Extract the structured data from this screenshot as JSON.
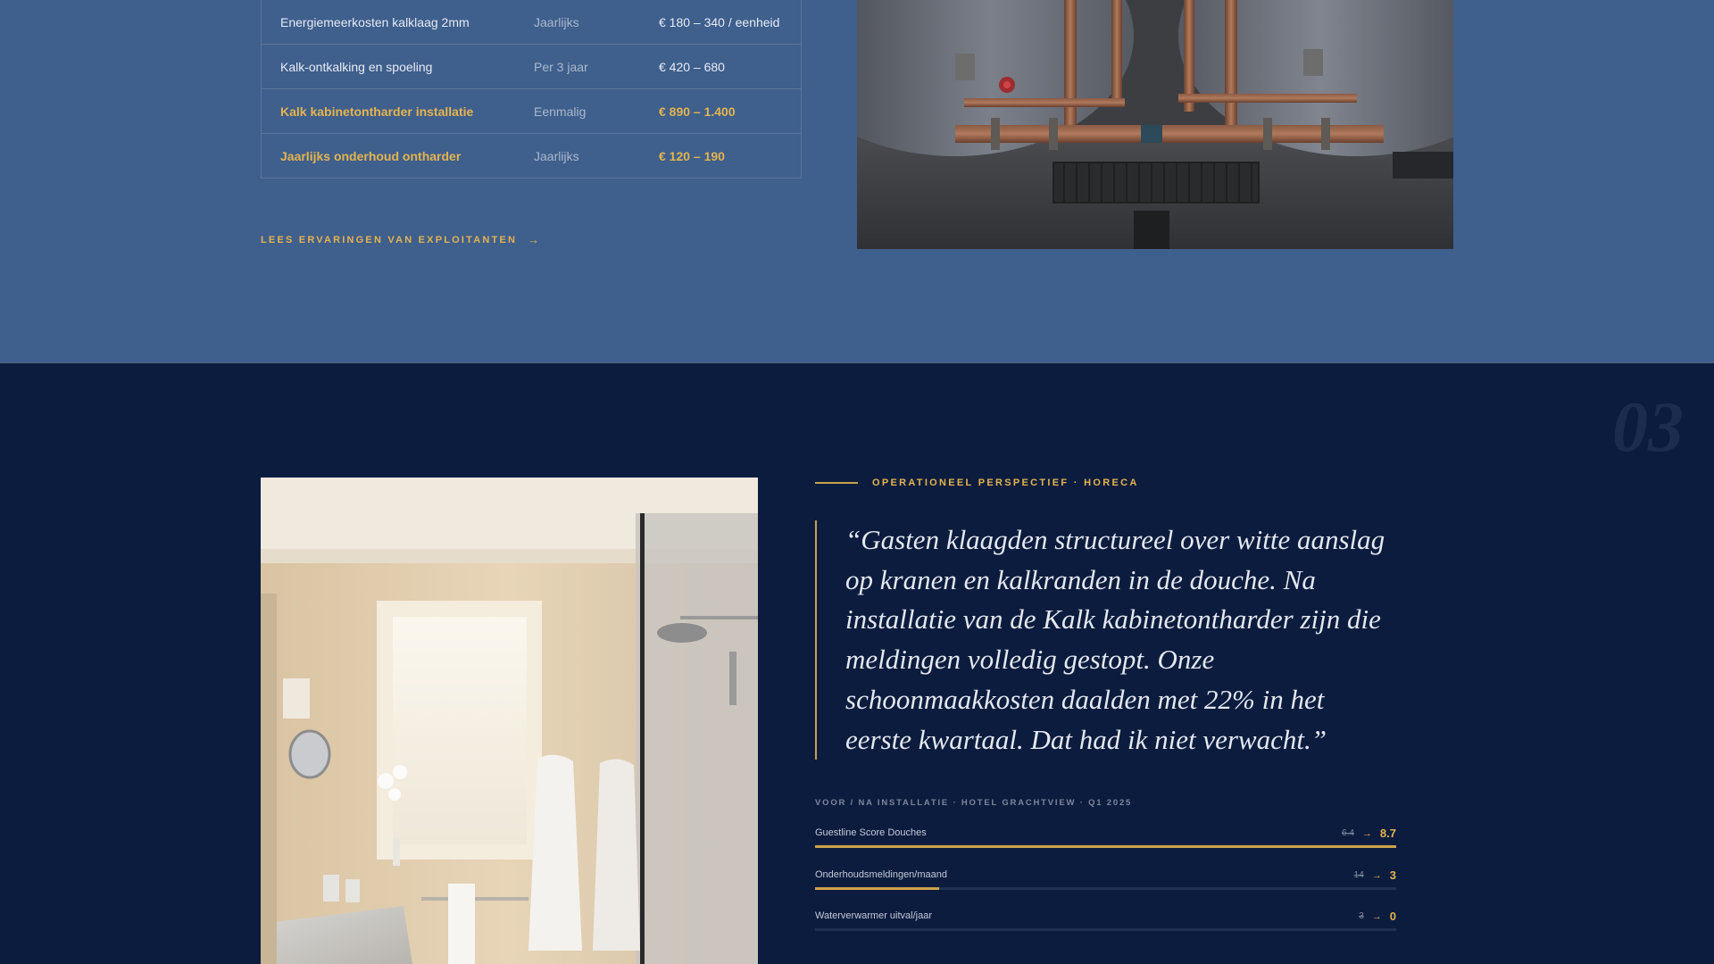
{
  "cost_table": {
    "rows": [
      {
        "item": "Energiemeerkosten kalklaag 2mm",
        "frequency": "Jaarlijks",
        "cost": "€ 180 – 340 / eenheid",
        "highlight": false
      },
      {
        "item": "Kalk-ontkalking en spoeling",
        "frequency": "Per 3 jaar",
        "cost": "€ 420 – 680",
        "highlight": false
      },
      {
        "item": "Kalk kabinetontharder installatie",
        "frequency": "Eenmalig",
        "cost": "€ 890 – 1.400",
        "highlight": true
      },
      {
        "item": "Jaarlijks onderhoud ontharder",
        "frequency": "Jaarlijks",
        "cost": "€ 120 – 190",
        "highlight": true
      }
    ]
  },
  "read_link": {
    "label": "LEES ERVARINGEN VAN EXPLOITANTEN",
    "icon": "arrow-right-icon"
  },
  "section": {
    "number": "03"
  },
  "testimonial": {
    "eyebrow": "OPERATIONEEL PERSPECTIEF · HORECA",
    "quote": "“Gasten klaagden structureel over witte aanslag op kranen en kalkranden in de douche. Na installatie van de Kalk kabinetontharder zijn die meldingen volledig gestopt. Onze schoonmaakkosten daalden met 22% in het eerste kwartaal. Dat had ik niet verwacht.”"
  },
  "stats": {
    "caption": "VOOR / NA INSTALLATIE · HOTEL GRACHTVIEW · Q1 2025",
    "items": [
      {
        "label": "Guestline Score Douches",
        "before": "6.4",
        "after": "8.7",
        "progress": 1.0
      },
      {
        "label": "Onderhoudsmeldingen/maand",
        "before": "14",
        "after": "3",
        "progress": 0.214
      },
      {
        "label": "Waterverwarmer uitval/jaar",
        "before": "3",
        "after": "0",
        "progress": 0.0
      }
    ]
  },
  "colors": {
    "accent": "#e3b44f",
    "upper_bg": "#3f5f8d",
    "lower_bg": "#0c1c3e"
  }
}
